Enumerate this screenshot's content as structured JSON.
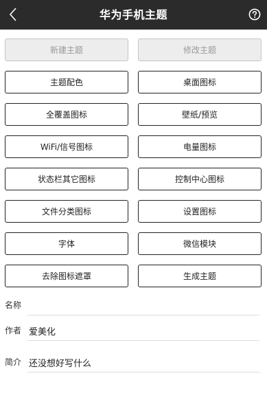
{
  "header": {
    "title": "华为手机主题",
    "back_icon": "chevron-left-icon",
    "help_icon": "help-circle-icon"
  },
  "buttons": [
    {
      "label": "新建主题",
      "enabled": false
    },
    {
      "label": "修改主题",
      "enabled": false
    },
    {
      "label": "主题配色",
      "enabled": true
    },
    {
      "label": "桌面图标",
      "enabled": true
    },
    {
      "label": "全覆盖图标",
      "enabled": true
    },
    {
      "label": "壁纸/预览",
      "enabled": true
    },
    {
      "label": "WiFi/信号图标",
      "enabled": true
    },
    {
      "label": "电量图标",
      "enabled": true
    },
    {
      "label": "状态栏其它图标",
      "enabled": true
    },
    {
      "label": "控制中心图标",
      "enabled": true
    },
    {
      "label": "文件分类图标",
      "enabled": true
    },
    {
      "label": "设置图标",
      "enabled": true
    },
    {
      "label": "字体",
      "enabled": true
    },
    {
      "label": "微信模块",
      "enabled": true
    },
    {
      "label": "去除图标遮罩",
      "enabled": true
    },
    {
      "label": "生成主题",
      "enabled": true
    }
  ],
  "form": {
    "name": {
      "label": "名称",
      "value": ""
    },
    "author": {
      "label": "作者",
      "value": "爱美化"
    },
    "intro": {
      "label": "简介",
      "value": "还没想好写什么"
    }
  },
  "colors": {
    "header_bg": "#2b2b2b",
    "button_border": "#222222",
    "disabled_bg": "#ededed"
  }
}
